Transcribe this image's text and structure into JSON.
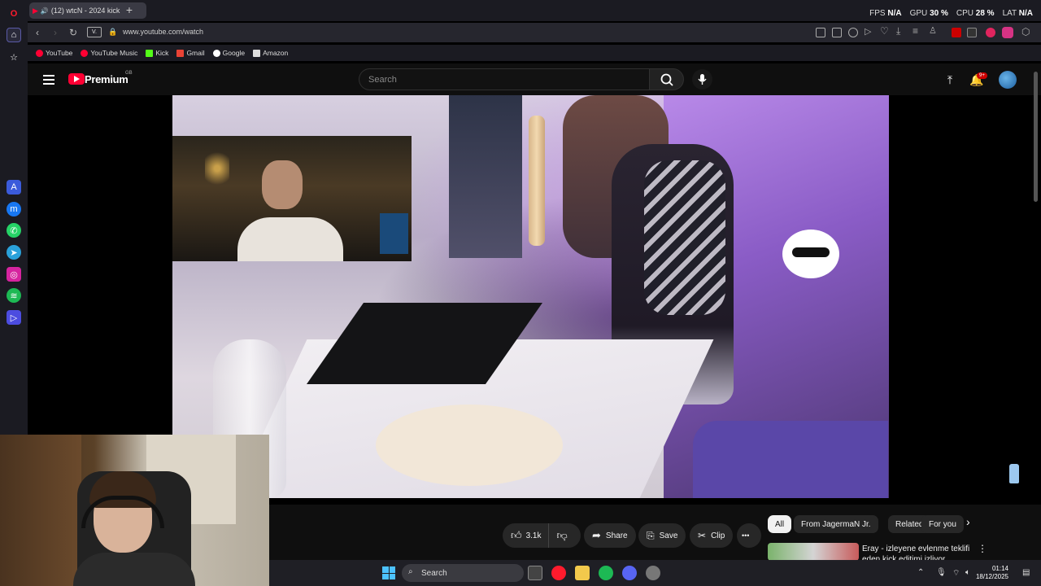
{
  "browser": {
    "tab_title": "(12) wtcN - 2024 kick",
    "new_tab": "+",
    "url": "www.youtube.com/watch",
    "site_badge": "V.",
    "perf": {
      "fps_label": "FPS",
      "fps_value": "N/A",
      "gpu_label": "GPU",
      "gpu_value": "30 %",
      "cpu_label": "CPU",
      "cpu_value": "28 %",
      "lat_label": "LAT",
      "lat_value": "N/A"
    },
    "bookmarks": [
      {
        "label": "YouTube",
        "color": "#ff0033"
      },
      {
        "label": "YouTube Music",
        "color": "#ff0033"
      },
      {
        "label": "Kick",
        "color": "#53fc18"
      },
      {
        "label": "Gmail",
        "color": "#ea4335"
      },
      {
        "label": "Google",
        "color": "#4285f4"
      },
      {
        "label": "Amazon",
        "color": "#ffffff"
      }
    ]
  },
  "youtube": {
    "logo_text": "Premium",
    "country_code": "GB",
    "search_placeholder": "Search",
    "notification_count": "9+"
  },
  "actions": {
    "like_count": "3.1k",
    "share_label": "Share",
    "save_label": "Save",
    "clip_label": "Clip",
    "more_label": "•••"
  },
  "chips": [
    "All",
    "From JagermaN Jr.",
    "Related",
    "For you"
  ],
  "recommendation": {
    "title": "Eray - izleyene evlenme teklifi eden kick editimi izliyor"
  },
  "taskbar": {
    "search_label": "Search",
    "time": "01:14",
    "date": "18/12/2025"
  },
  "colors": {
    "accent_red": "#ff0033",
    "background": "#0f0f0f",
    "pill": "#272727"
  }
}
